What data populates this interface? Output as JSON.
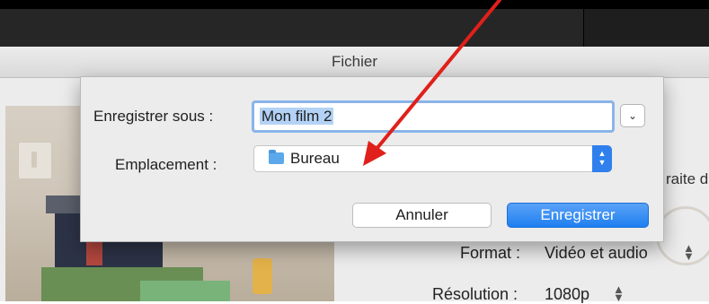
{
  "window": {
    "title": "Fichier"
  },
  "dialog": {
    "save_as_label": "Enregistrer sous :",
    "save_as_value": "Mon film 2",
    "location_label": "Emplacement :",
    "location_value": "Bureau",
    "location_icon": "folder-icon",
    "cancel_label": "Annuler",
    "save_label": "Enregistrer",
    "accent_color": "#2f80ed"
  },
  "settings": {
    "partial_text": "raite d",
    "format_label": "Format :",
    "format_value": "Vidéo et audio",
    "resolution_label": "Résolution :",
    "resolution_value": "1080p"
  },
  "annotation": {
    "arrow_color": "#e0201a"
  }
}
